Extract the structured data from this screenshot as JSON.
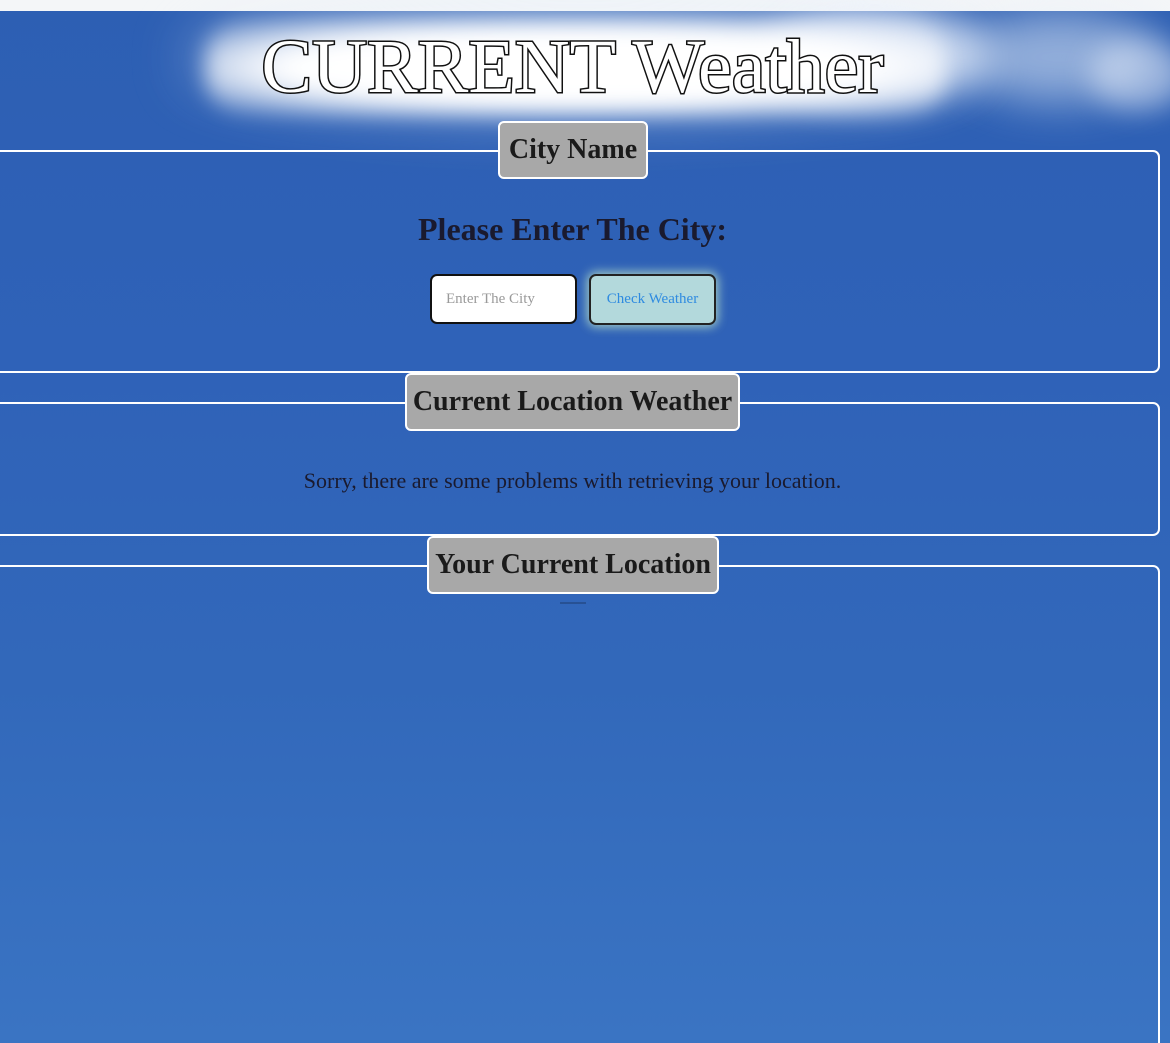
{
  "header": {
    "title": "CURRENT Weather"
  },
  "city_section": {
    "legend": "City Name",
    "prompt": "Please Enter The City:",
    "input_placeholder": "Enter The City",
    "input_value": "",
    "button_label": "Check Weather"
  },
  "current_weather_section": {
    "legend": "Current Location Weather",
    "message": "Sorry, there are some problems with retrieving your location."
  },
  "location_section": {
    "legend": "Your Current Location"
  },
  "colors": {
    "background_sky": "#2f62b8",
    "legend_fill": "#a8a8a8",
    "panel_border": "#ffffff",
    "button_fill": "#b3d9dc",
    "button_text": "#2f8be0"
  }
}
